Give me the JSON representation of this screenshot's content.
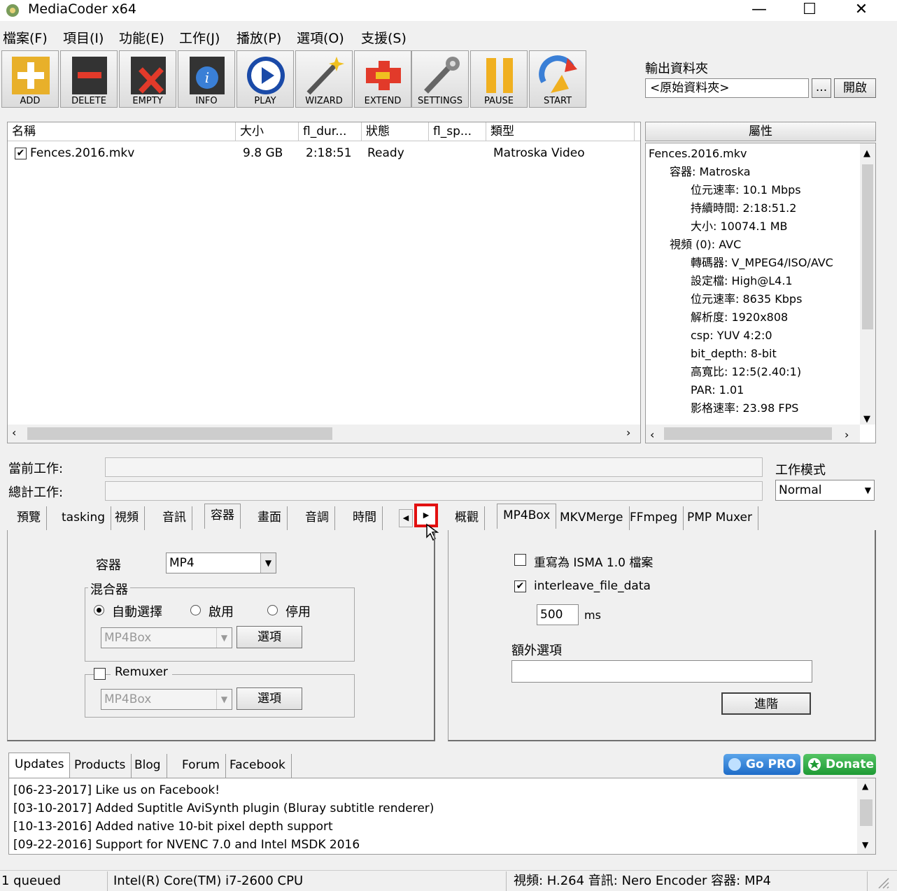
{
  "titlebar": {
    "title": "MediaCoder x64",
    "minimize": "—",
    "maximize": "☐",
    "close": "✕"
  },
  "menu": [
    "檔案(F)",
    "項目(I)",
    "功能(E)",
    "工作(J)",
    "播放(P)",
    "選項(O)",
    "支援(S)"
  ],
  "toolbar": [
    {
      "label": "ADD",
      "icon": "add-icon"
    },
    {
      "label": "DELETE",
      "icon": "delete-icon"
    },
    {
      "label": "EMPTY",
      "icon": "empty-icon"
    },
    {
      "label": "INFO",
      "icon": "info-icon"
    },
    {
      "label": "PLAY",
      "icon": "play-icon"
    },
    {
      "label": "WIZARD",
      "icon": "wizard-icon"
    },
    {
      "label": "EXTEND",
      "icon": "extend-icon"
    },
    {
      "label": "SETTINGS",
      "icon": "settings-icon"
    },
    {
      "label": "PAUSE",
      "icon": "pause-icon"
    },
    {
      "label": "START",
      "icon": "start-icon"
    }
  ],
  "output": {
    "label": "輸出資料夾",
    "value": "<原始資料夾>",
    "browse": "...",
    "open": "開啟"
  },
  "filelist": {
    "columns": [
      "名稱",
      "大小",
      "fl_dur...",
      "狀態",
      "fl_sp...",
      "類型"
    ],
    "rows": [
      {
        "name": "Fences.2016.mkv",
        "size": "9.8 GB",
        "duration": "2:18:51",
        "status": "Ready",
        "speed": "",
        "type": "Matroska Video",
        "checked": true
      }
    ]
  },
  "properties": {
    "header": "屬性",
    "tree": [
      "Fences.2016.mkv",
      "容器: Matroska",
      "位元速率: 10.1 Mbps",
      "持續時間: 2:18:51.2",
      "大小: 10074.1 MB",
      "視頻 (0): AVC",
      "轉碼器: V_MPEG4/ISO/AVC",
      "設定檔: High@L4.1",
      "位元速率: 8635 Kbps",
      "解析度: 1920x808",
      "csp: YUV 4:2:0",
      "bit_depth: 8-bit",
      "高寬比: 12:5(2.40:1)",
      "PAR: 1.01",
      "影格速率: 23.98 FPS"
    ]
  },
  "progress": {
    "current_label": "當前工作:",
    "total_label": "總計工作:",
    "mode_label": "工作模式",
    "mode_value": "Normal"
  },
  "left_tabs": [
    "預覽",
    "tasking",
    "視頻",
    "音訊",
    "容器",
    "畫面",
    "音調",
    "時間"
  ],
  "container_panel": {
    "container_label": "容器",
    "container_value": "MP4",
    "muxer_group": "混合器",
    "radios": [
      "自動選擇",
      "啟用",
      "停用"
    ],
    "muxer_value": "MP4Box",
    "muxer_options": "選項",
    "remuxer_label": "Remuxer",
    "remuxer_value": "MP4Box",
    "remuxer_options": "選項"
  },
  "right_tabs": [
    "概觀",
    "MP4Box",
    "MKVMerge",
    "FFmpeg",
    "PMP Muxer"
  ],
  "mp4box_panel": {
    "isma_label": "重寫為 ISMA 1.0 檔案",
    "interleave_label": "interleave_file_data",
    "interleave_value": "500",
    "ms": "ms",
    "extra_label": "額外選項",
    "extra_value": "",
    "advanced": "進階"
  },
  "news_tabs": [
    "Updates",
    "Products",
    "Blog",
    "Forum",
    "Facebook"
  ],
  "news_buttons": {
    "gopro": "Go PRO",
    "donate": "Donate"
  },
  "news": [
    "[06-23-2017] Like us on Facebook!",
    "[03-10-2017] Added Suptitle AviSynth plugin (Bluray subtitle renderer)",
    "[10-13-2016] Added native 10-bit pixel depth support",
    "[09-22-2016] Support for NVENC 7.0 and Intel MSDK 2016"
  ],
  "statusbar": {
    "queued": "1 queued",
    "cpu": "Intel(R) Core(TM) i7-2600 CPU",
    "codec": "視頻: H.264  音訊: Nero Encoder  容器: MP4"
  }
}
